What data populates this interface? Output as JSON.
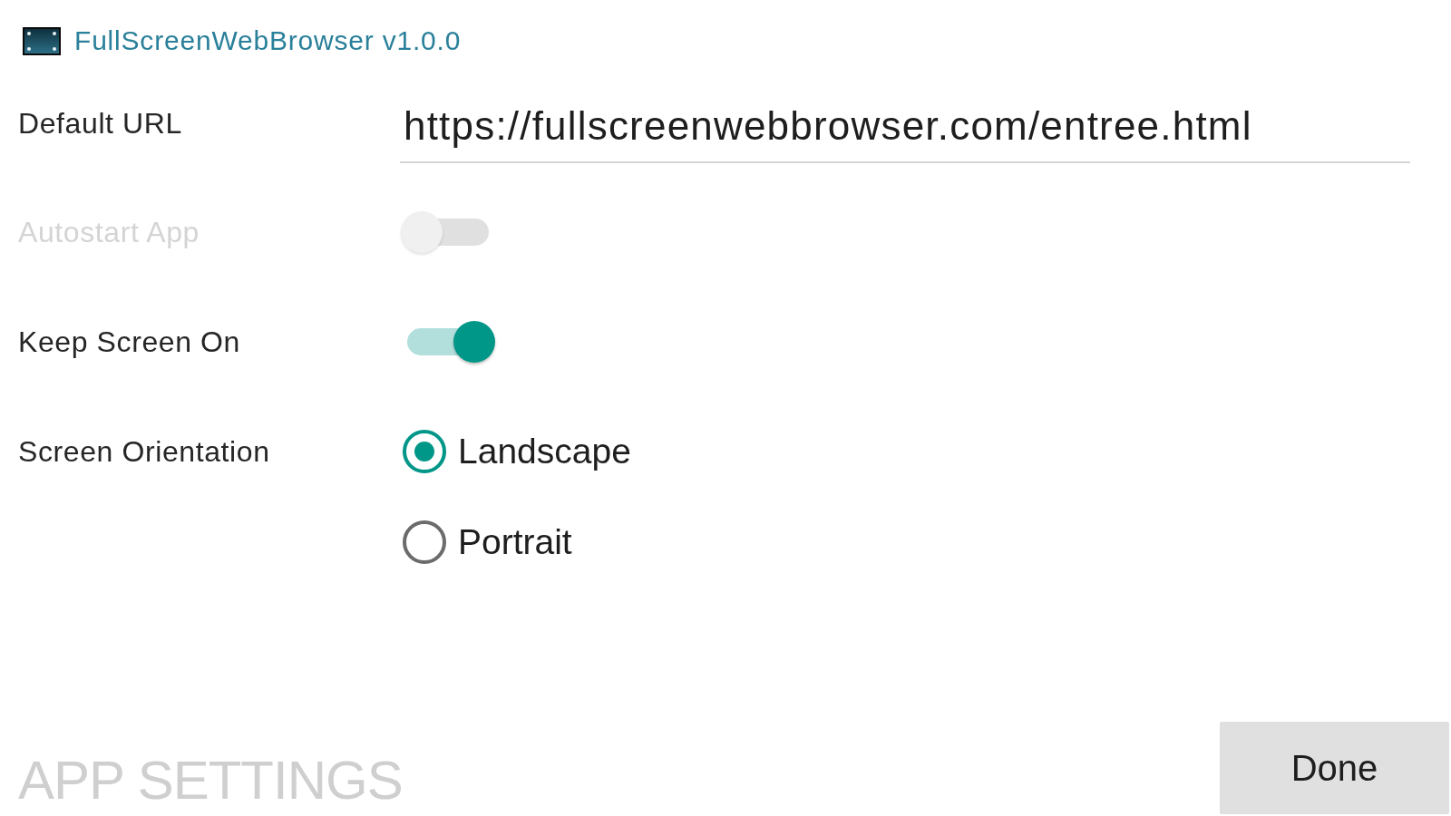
{
  "header": {
    "title": "FullScreenWebBrowser v1.0.0"
  },
  "settings": [
    {
      "kind": "field",
      "label": "Default URL",
      "disabled": false,
      "value": "https://fullscreenwebbrowser.com/entree.html"
    },
    {
      "kind": "toggle",
      "label": "Autostart App",
      "disabled": true,
      "on": false
    },
    {
      "kind": "toggle",
      "label": "Keep Screen On",
      "disabled": false,
      "on": true
    },
    {
      "kind": "radio",
      "label": "Screen Orientation",
      "disabled": false,
      "options": [
        {
          "label": "Landscape",
          "selected": true
        },
        {
          "label": "Portrait",
          "selected": false
        }
      ]
    }
  ],
  "footer": {
    "title": "APP SETTINGS",
    "buttons": [
      "Done"
    ]
  }
}
